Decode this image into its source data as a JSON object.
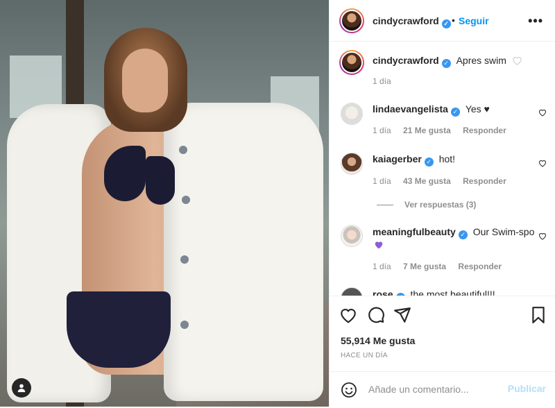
{
  "header": {
    "username": "cindycrawford",
    "separator": "•",
    "follow_label": "Seguir",
    "more_label": "•••"
  },
  "caption": {
    "username": "cindycrawford",
    "text": "Apres swim",
    "time": "1 día"
  },
  "comments": [
    {
      "username": "lindaevangelista",
      "text": "Yes ♥",
      "time": "1 día",
      "likes": "21 Me gusta",
      "reply_label": "Responder"
    },
    {
      "username": "kaiagerber",
      "text": "hot!",
      "time": "1 día",
      "likes": "43 Me gusta",
      "reply_label": "Responder",
      "view_replies": "Ver respuestas (3)"
    },
    {
      "username": "meaningfulbeauty",
      "text": "Our Swim-spo",
      "emoji": "💜",
      "time": "1 día",
      "likes": "7 Me gusta",
      "reply_label": "Responder"
    },
    {
      "username": "rose",
      "text": "the most beautiful!!!"
    }
  ],
  "post": {
    "likes": "55,914 Me gusta",
    "time": "HACE UN DÍA"
  },
  "comment_box": {
    "placeholder": "Añade un comentario...",
    "publish_label": "Publicar"
  },
  "colors": {
    "accent": "#0095f6",
    "verified": "#3897f0",
    "muted": "#8e8e8e",
    "publish_disabled": "#b2dffc"
  }
}
